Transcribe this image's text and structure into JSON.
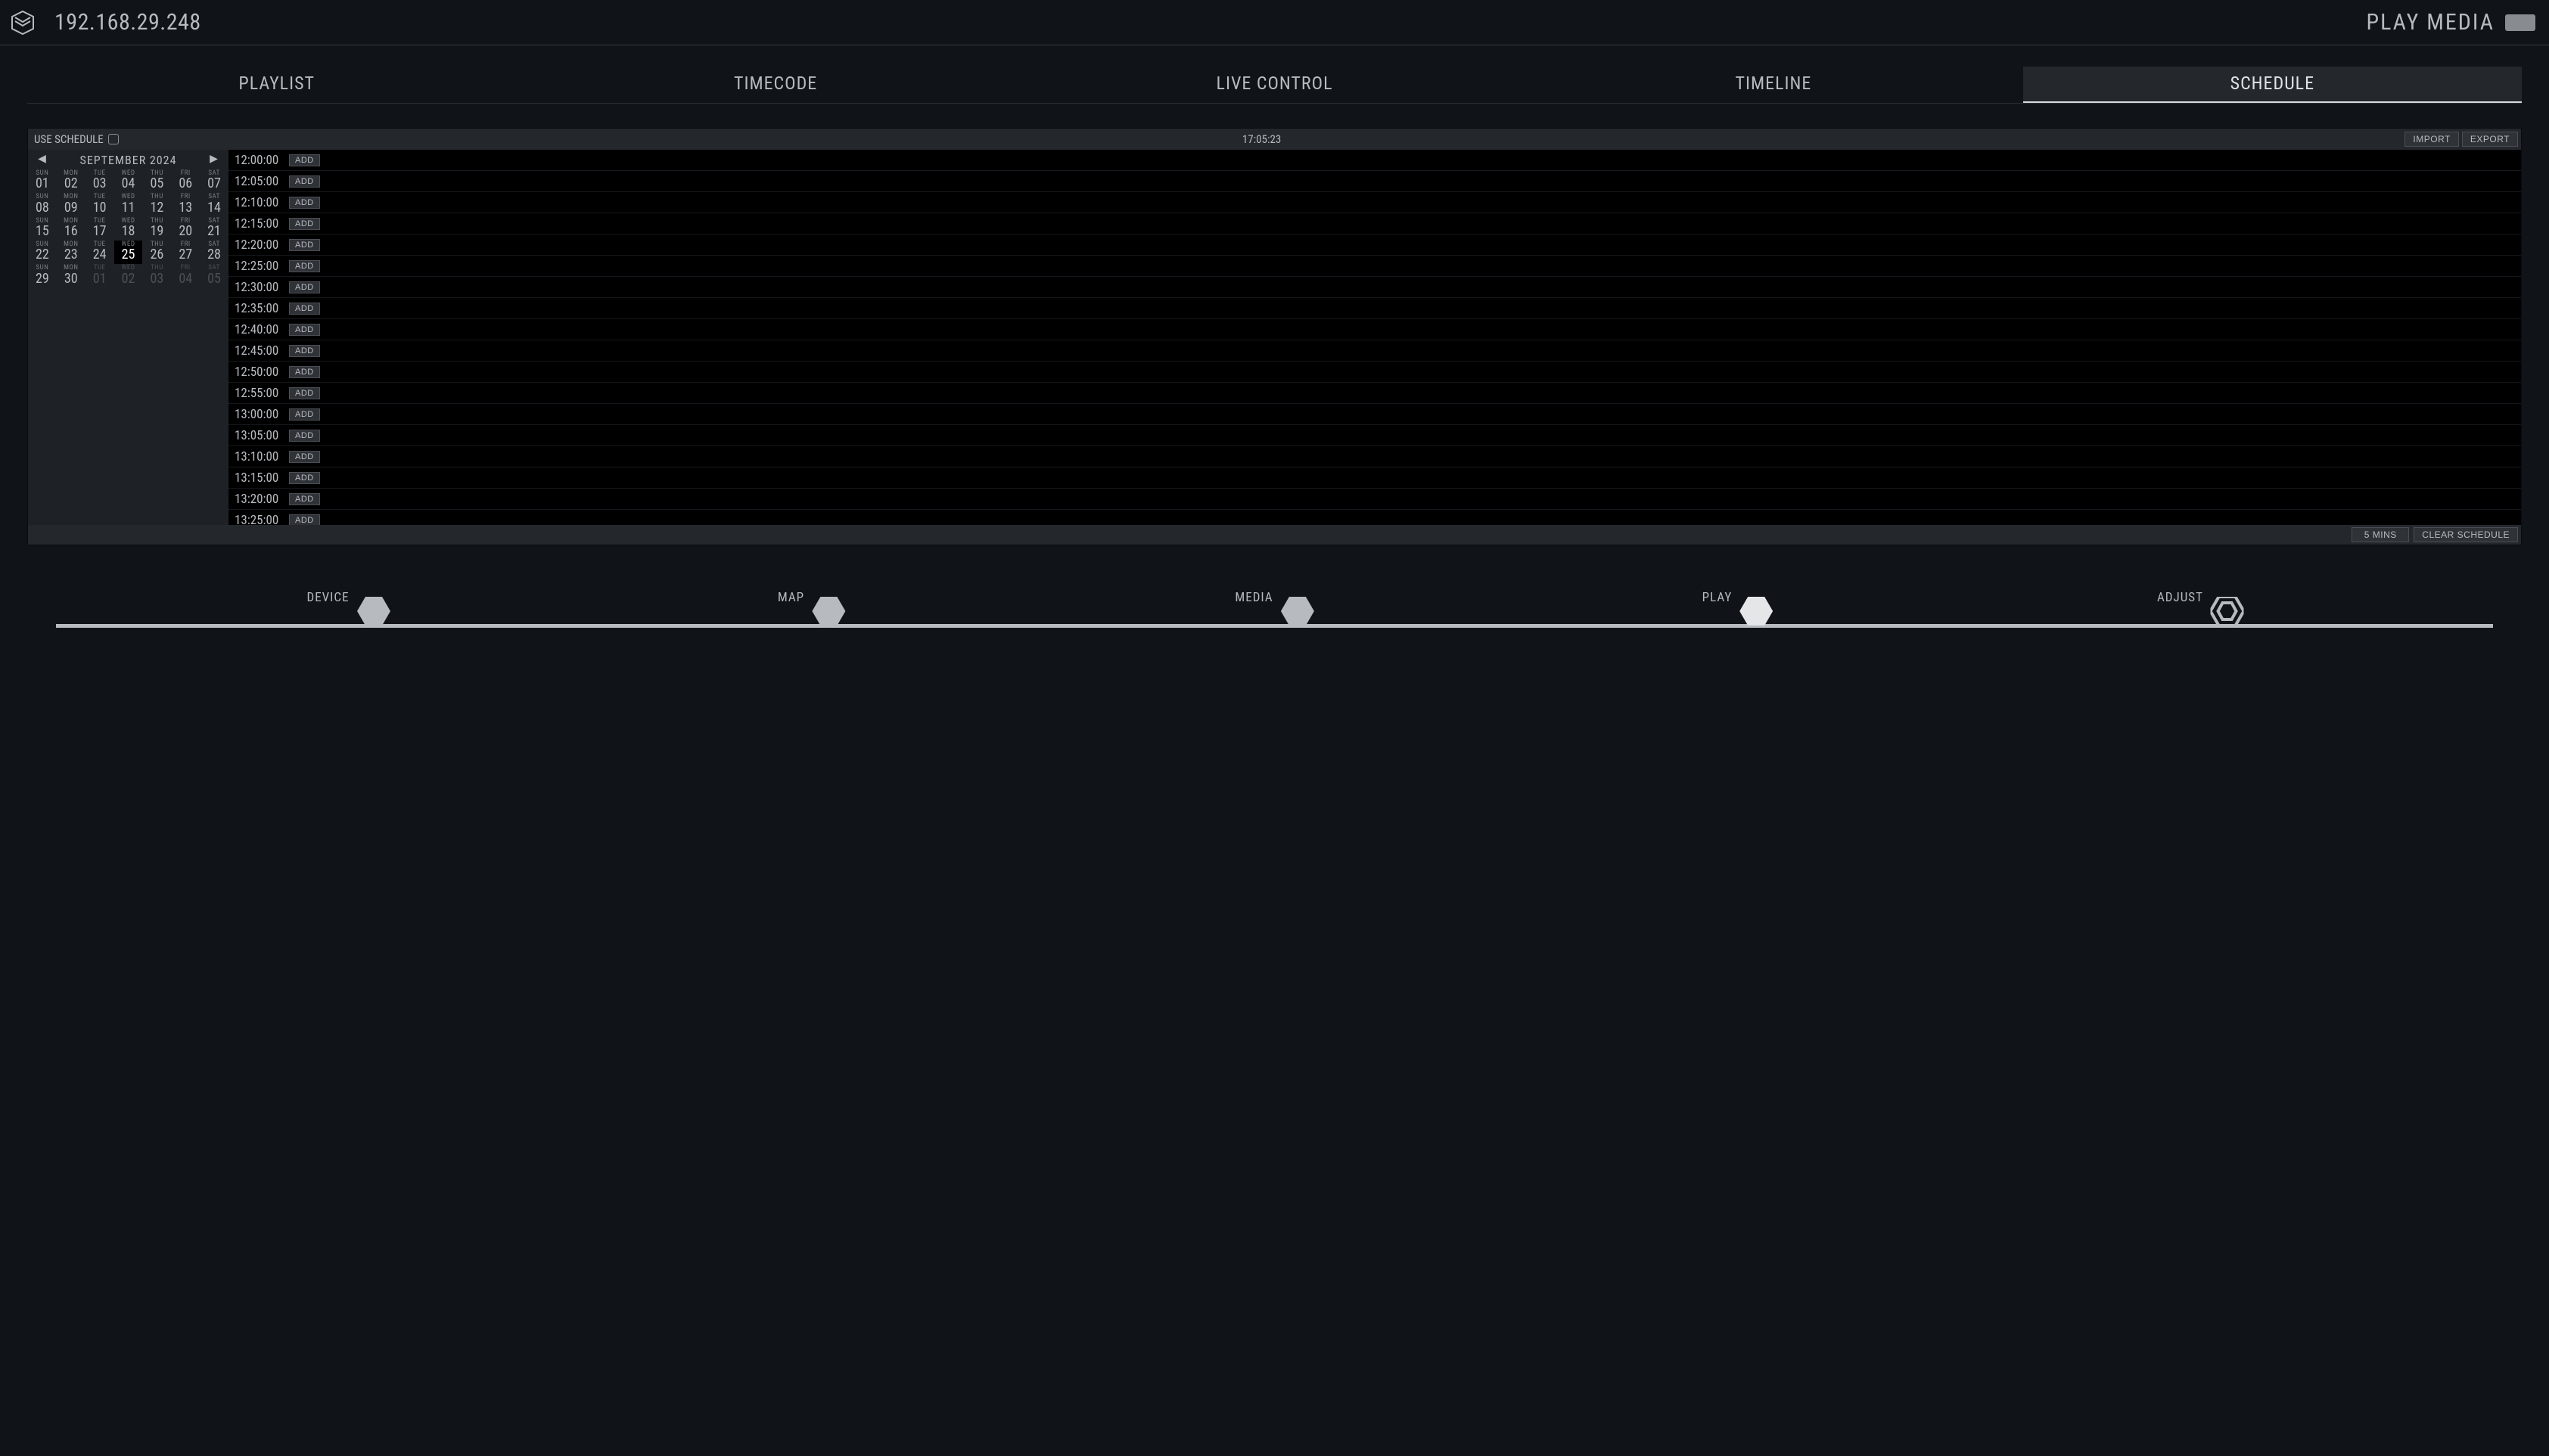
{
  "header": {
    "ip": "192.168.29.248",
    "title": "PLAY MEDIA"
  },
  "tabs": [
    "PLAYLIST",
    "TIMECODE",
    "LIVE CONTROL",
    "TIMELINE",
    "SCHEDULE"
  ],
  "active_tab": 4,
  "schedule": {
    "use_schedule_label": "USE SCHEDULE",
    "use_schedule_checked": false,
    "current_time": "17:05:23",
    "import_label": "IMPORT",
    "export_label": "EXPORT",
    "interval_label": "5 MINS",
    "clear_label": "CLEAR SCHEDULE",
    "add_label": "ADD"
  },
  "calendar": {
    "month_label": "SEPTEMBER 2024",
    "rows": [
      [
        {
          "dow": "SUN",
          "num": "01"
        },
        {
          "dow": "MON",
          "num": "02"
        },
        {
          "dow": "TUE",
          "num": "03"
        },
        {
          "dow": "WED",
          "num": "04"
        },
        {
          "dow": "THU",
          "num": "05"
        },
        {
          "dow": "FRI",
          "num": "06"
        },
        {
          "dow": "SAT",
          "num": "07"
        }
      ],
      [
        {
          "dow": "SUN",
          "num": "08"
        },
        {
          "dow": "MON",
          "num": "09"
        },
        {
          "dow": "TUE",
          "num": "10"
        },
        {
          "dow": "WED",
          "num": "11"
        },
        {
          "dow": "THU",
          "num": "12"
        },
        {
          "dow": "FRI",
          "num": "13"
        },
        {
          "dow": "SAT",
          "num": "14"
        }
      ],
      [
        {
          "dow": "SUN",
          "num": "15"
        },
        {
          "dow": "MON",
          "num": "16"
        },
        {
          "dow": "TUE",
          "num": "17"
        },
        {
          "dow": "WED",
          "num": "18"
        },
        {
          "dow": "THU",
          "num": "19"
        },
        {
          "dow": "FRI",
          "num": "20"
        },
        {
          "dow": "SAT",
          "num": "21"
        }
      ],
      [
        {
          "dow": "SUN",
          "num": "22"
        },
        {
          "dow": "MON",
          "num": "23"
        },
        {
          "dow": "TUE",
          "num": "24"
        },
        {
          "dow": "WED",
          "num": "25",
          "selected": true
        },
        {
          "dow": "THU",
          "num": "26"
        },
        {
          "dow": "FRI",
          "num": "27"
        },
        {
          "dow": "SAT",
          "num": "28"
        }
      ],
      [
        {
          "dow": "SUN",
          "num": "29"
        },
        {
          "dow": "MON",
          "num": "30"
        },
        {
          "dow": "TUE",
          "num": "01",
          "other": true
        },
        {
          "dow": "WED",
          "num": "02",
          "other": true
        },
        {
          "dow": "THU",
          "num": "03",
          "other": true
        },
        {
          "dow": "FRI",
          "num": "04",
          "other": true
        },
        {
          "dow": "SAT",
          "num": "05",
          "other": true
        }
      ]
    ]
  },
  "slots": [
    "12:00:00",
    "12:05:00",
    "12:10:00",
    "12:15:00",
    "12:20:00",
    "12:25:00",
    "12:30:00",
    "12:35:00",
    "12:40:00",
    "12:45:00",
    "12:50:00",
    "12:55:00",
    "13:00:00",
    "13:05:00",
    "13:10:00",
    "13:15:00",
    "13:20:00",
    "13:25:00"
  ],
  "steps": {
    "items": [
      "DEVICE",
      "MAP",
      "MEDIA",
      "PLAY",
      "ADJUST"
    ],
    "active": 3
  }
}
